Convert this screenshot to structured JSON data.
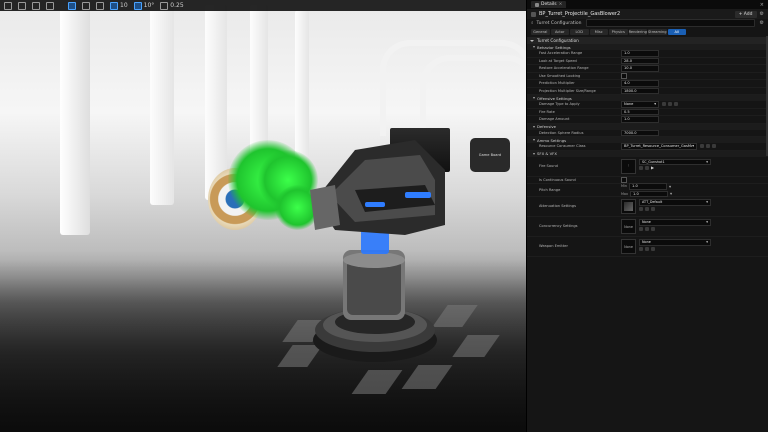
{
  "viewport": {
    "toolbar": [
      {
        "icon": "menu-icon",
        "label": ""
      },
      {
        "icon": "perspective-icon",
        "label": ""
      },
      {
        "icon": "lit-mode-icon",
        "label": ""
      },
      {
        "icon": "show-icon",
        "label": ""
      },
      {
        "icon": "translate-icon",
        "label": ""
      },
      {
        "icon": "rotate-icon",
        "label": ""
      },
      {
        "icon": "scale-icon",
        "label": ""
      },
      {
        "icon": "grid-snap-icon",
        "label": "10"
      },
      {
        "icon": "angle-snap-icon",
        "label": "10°"
      },
      {
        "icon": "scale-snap-icon",
        "label": "0.25"
      }
    ],
    "sign_text": "Game Board"
  },
  "details": {
    "tab_label": "Details",
    "actor_name": "BP_Turret_Projectile_GasBlower2",
    "add_label": "+ Add",
    "search_sub": "Turret Configuration",
    "category_tabs": [
      "General",
      "Actor",
      "LOD",
      "Misc",
      "Physics",
      "Rendering",
      "Streaming",
      "All"
    ],
    "active_tab": "All",
    "section_turret": "Turret Configuration",
    "sub_behavior": "Behavior Settings",
    "behavior_props": [
      {
        "label": "Fast Acceleration Range",
        "value": "1.0"
      },
      {
        "label": "Look at Target Speed",
        "value": "28.0"
      },
      {
        "label": "Restore Acceleration Range",
        "value": "10.0"
      },
      {
        "label": "Use Smoothed Looking",
        "value": ""
      },
      {
        "label": "Prediction Multiplier",
        "value": "4.0"
      },
      {
        "label": "Projection Multiplier Size/Range",
        "value": "1800.0"
      }
    ],
    "sub_offensive": "Offensive Settings",
    "offensive_props": [
      {
        "label": "Damage Type to Apply",
        "value": "None"
      },
      {
        "label": "Fire Rate",
        "value": "0.5"
      },
      {
        "label": "Damage Amount",
        "value": "1.0"
      }
    ],
    "sub_defensive": "Defensive",
    "defensive_props": [
      {
        "label": "Detection Sphere Radius",
        "value": "7000.0"
      }
    ],
    "sub_ammo": "Ammo Settings",
    "ammo_props": [
      {
        "label": "Resource Consumer Class",
        "value": "BP_Turret_Resource_Consumer_GasMa..."
      }
    ],
    "sub_fx": "SFX & VFX",
    "fx_props": [
      {
        "label": "Fire Sound",
        "value": "SC_Gunshot1",
        "thumb": ""
      },
      {
        "label": "Is Continuous Sound",
        "value": "",
        "thumb": ""
      },
      {
        "label": "Pitch Range",
        "min_label": "Min",
        "min": "1.0",
        "max_label": "Max",
        "max": "1.0"
      },
      {
        "label": "Attenuation Settings",
        "value": "ATT_Default",
        "thumb": ""
      },
      {
        "label": "Concurrency Settings",
        "value": "None",
        "thumb": "None"
      },
      {
        "label": "Weapon Emitter",
        "value": "None",
        "thumb": "None"
      }
    ]
  }
}
